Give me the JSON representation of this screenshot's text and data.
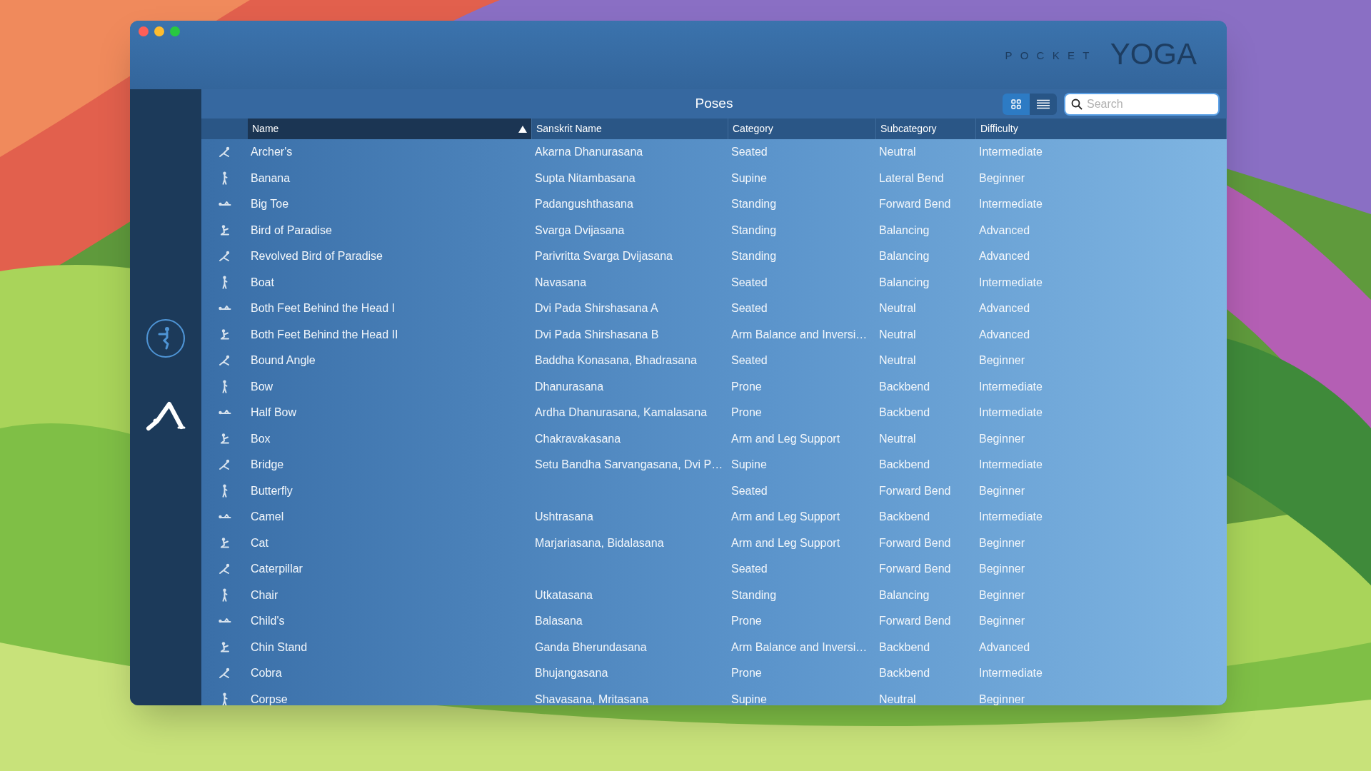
{
  "app": {
    "logo": {
      "prefix": "POCKET",
      "name": "YOGA"
    }
  },
  "sidebar": {
    "items": [
      {
        "kind": "chair",
        "selected": false
      },
      {
        "kind": "downdog",
        "selected": true
      }
    ]
  },
  "toolbar": {
    "title": "Poses",
    "view_toggle": [
      {
        "kind": "grid",
        "selected": true
      },
      {
        "kind": "list",
        "selected": false
      }
    ],
    "search": {
      "placeholder": "Search"
    }
  },
  "table": {
    "columns": [
      {
        "label": "Name",
        "sorted": true
      },
      {
        "label": "Sanskrit Name",
        "sorted": false
      },
      {
        "label": "Category",
        "sorted": false
      },
      {
        "label": "Subcategory",
        "sorted": false
      },
      {
        "label": "Difficulty",
        "sorted": false
      }
    ],
    "rows": [
      [
        "Archer's",
        "Akarna Dhanurasana",
        "Seated",
        "Neutral",
        "Intermediate"
      ],
      [
        "Banana",
        "Supta Nitambasana",
        "Supine",
        "Lateral Bend",
        "Beginner"
      ],
      [
        "Big Toe",
        "Padangushthasana",
        "Standing",
        "Forward Bend",
        "Intermediate"
      ],
      [
        "Bird of Paradise",
        "Svarga Dvijasana",
        "Standing",
        "Balancing",
        "Advanced"
      ],
      [
        "Revolved Bird of Paradise",
        "Parivritta Svarga Dvijasana",
        "Standing",
        "Balancing",
        "Advanced"
      ],
      [
        "Boat",
        "Navasana",
        "Seated",
        "Balancing",
        "Intermediate"
      ],
      [
        "Both Feet Behind the Head I",
        "Dvi Pada Shirshasana A",
        "Seated",
        "Neutral",
        "Advanced"
      ],
      [
        "Both Feet Behind the Head II",
        "Dvi Pada Shirshasana B",
        "Arm Balance and Inversi…",
        "Neutral",
        "Advanced"
      ],
      [
        "Bound Angle",
        "Baddha Konasana, Bhadrasana",
        "Seated",
        "Neutral",
        "Beginner"
      ],
      [
        "Bow",
        "Dhanurasana",
        "Prone",
        "Backbend",
        "Intermediate"
      ],
      [
        "Half Bow",
        "Ardha Dhanurasana, Kamalasana",
        "Prone",
        "Backbend",
        "Intermediate"
      ],
      [
        "Box",
        "Chakravakasana",
        "Arm and Leg Support",
        "Neutral",
        "Beginner"
      ],
      [
        "Bridge",
        "Setu Bandha Sarvangasana, Dvi P…",
        "Supine",
        "Backbend",
        "Intermediate"
      ],
      [
        "Butterfly",
        "",
        "Seated",
        "Forward Bend",
        "Beginner"
      ],
      [
        "Camel",
        "Ushtrasana",
        "Arm and Leg Support",
        "Backbend",
        "Intermediate"
      ],
      [
        "Cat",
        "Marjariasana, Bidalasana",
        "Arm and Leg Support",
        "Forward Bend",
        "Beginner"
      ],
      [
        "Caterpillar",
        "",
        "Seated",
        "Forward Bend",
        "Beginner"
      ],
      [
        "Chair",
        "Utkatasana",
        "Standing",
        "Balancing",
        "Beginner"
      ],
      [
        "Child's",
        "Balasana",
        "Prone",
        "Forward Bend",
        "Beginner"
      ],
      [
        "Chin Stand",
        "Ganda Bherundasana",
        "Arm Balance and Inversi…",
        "Backbend",
        "Advanced"
      ],
      [
        "Cobra",
        "Bhujangasana",
        "Prone",
        "Backbend",
        "Intermediate"
      ],
      [
        "Corpse",
        "Shavasana, Mritasana",
        "Supine",
        "Neutral",
        "Beginner"
      ]
    ]
  }
}
